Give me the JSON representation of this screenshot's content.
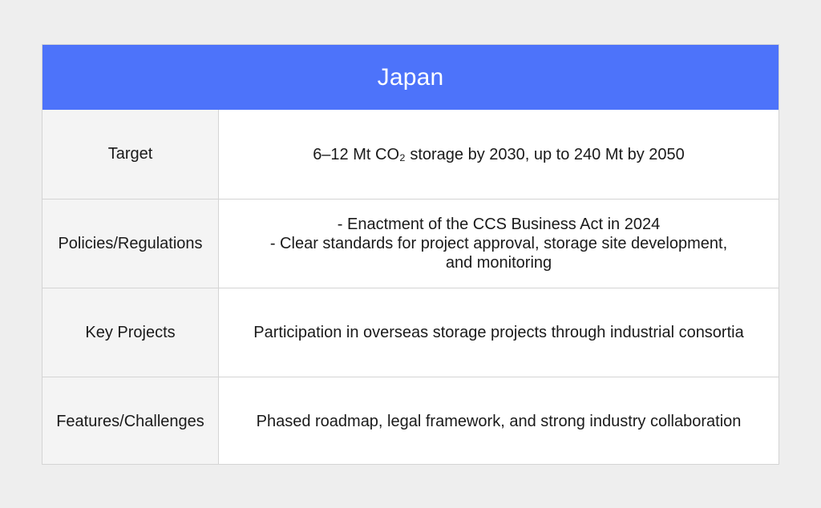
{
  "table": {
    "title": "Japan",
    "rows": [
      {
        "label": "Target",
        "lines": [
          "6–12 Mt CO₂ storage by 2030, up to 240 Mt by 2050"
        ]
      },
      {
        "label": "Policies/Regulations",
        "lines": [
          "- Enactment of the CCS Business Act in 2024",
          "- Clear standards for project approval, storage site development,",
          "and monitoring"
        ]
      },
      {
        "label": "Key Projects",
        "lines": [
          "Participation in overseas storage projects through industrial consortia"
        ]
      },
      {
        "label": "Features/Challenges",
        "lines": [
          "Phased roadmap, legal framework, and strong industry collaboration"
        ]
      }
    ]
  },
  "colors": {
    "header_bg": "#4d73fa",
    "label_bg": "#f4f4f4",
    "page_bg": "#eeeeee",
    "border": "#d4d4d4"
  }
}
